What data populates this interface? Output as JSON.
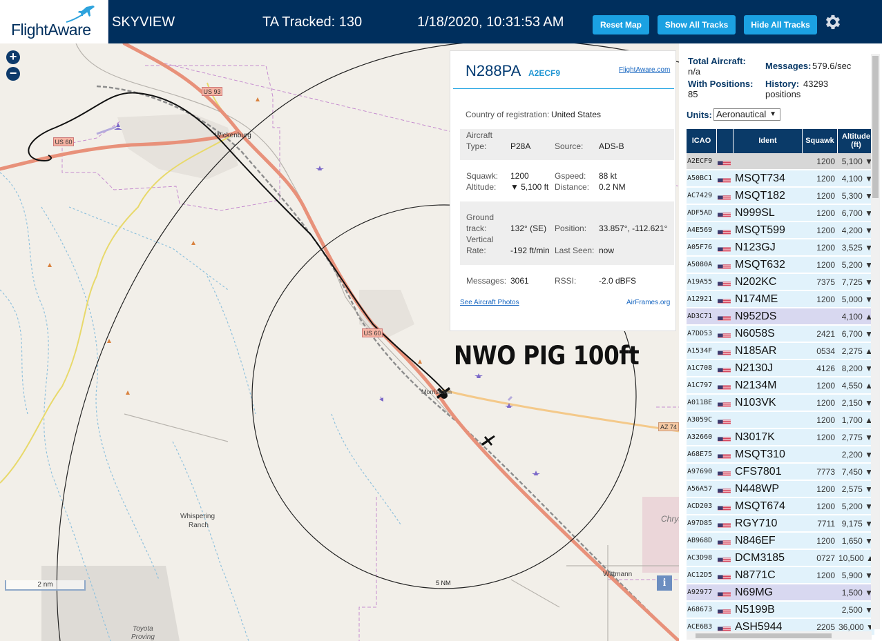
{
  "header": {
    "logo_text": "FlightAware",
    "app_name": "SKYVIEW",
    "tracked": "TA Tracked: 130",
    "datetime": "1/18/2020, 10:31:53 AM",
    "buttons": {
      "reset": "Reset Map",
      "show_all": "Show All Tracks",
      "hide_all": "Hide All Tracks"
    }
  },
  "map": {
    "zoom_in": "+",
    "zoom_out": "−",
    "scale_label": "2 nm",
    "range_label": "5 NM",
    "annotation": "NWO PIG 100ft",
    "info_button": "i",
    "places": {
      "wickenburg": "Wickenburg",
      "morristown": "Morristown",
      "whispering_ranch_1": "Whispering",
      "whispering_ranch_2": "Ranch",
      "wittmann": "Wittmann",
      "toyota_1": "Toyota",
      "toyota_2": "Proving",
      "chrys": "Chrys"
    },
    "shields": {
      "us93": "US 93",
      "us60a": "US 60",
      "us60b": "US 60",
      "az74": "AZ 74"
    }
  },
  "popup": {
    "registration": "N288PA",
    "hex": "A2ECF9",
    "link": "FlightAware.com",
    "country_label": "Country of registration:",
    "country_value": "United States",
    "type_label_1": "Aircraft",
    "type_label_2": "Type:",
    "type_value": "P28A",
    "source_label": "Source:",
    "source_value": "ADS-B",
    "squawk_label": "Squawk:",
    "squawk_value": "1200",
    "gspeed_label": "Gspeed:",
    "gspeed_value": "88 kt",
    "altitude_label": "Altitude:",
    "altitude_value": "▼ 5,100 ft",
    "distance_label": "Distance:",
    "distance_value": "0.2 NM",
    "gtrack_label_1": "Ground",
    "gtrack_label_2": "track:",
    "gtrack_value": "132° (SE)",
    "position_label": "Position:",
    "position_value": "33.857°, -112.621°",
    "vrate_label_1": "Vertical",
    "vrate_label_2": "Rate:",
    "vrate_value": "-192 ft/min",
    "lastseen_label": "Last Seen:",
    "lastseen_value": "now",
    "messages_label": "Messages:",
    "messages_value": "3061",
    "rssi_label": "RSSI:",
    "rssi_value": "-2.0 dBFS",
    "photos_link": "See Aircraft Photos",
    "airframes_link": "AirFrames.org"
  },
  "sidebar": {
    "total_label": "Total Aircraft:",
    "total_value": "n/a",
    "messages_label": "Messages:",
    "messages_value": "579.6/sec",
    "withpos_label": "With Positions:",
    "withpos_value": "85",
    "history_label": "History:",
    "history_value": "43293",
    "history_unit": "positions",
    "units_label": "Units:",
    "units_value": "Aeronautical",
    "columns": {
      "icao": "ICAO",
      "ident": "Ident",
      "squawk": "Squawk",
      "alt_1": "Altitude",
      "alt_2": "(ft)"
    },
    "rows": [
      {
        "icao": "A2ECF9",
        "ident": "",
        "squawk": "1200",
        "alt": "5,100 ▼",
        "state": "sel"
      },
      {
        "icao": "A50BC1",
        "ident": "MSQT734",
        "squawk": "1200",
        "alt": "4,100 ▼",
        "state": ""
      },
      {
        "icao": "AC7429",
        "ident": "MSQT182",
        "squawk": "1200",
        "alt": "5,300 ▼",
        "state": ""
      },
      {
        "icao": "ADF5AD",
        "ident": "N999SL",
        "squawk": "1200",
        "alt": "6,700 ▼",
        "state": ""
      },
      {
        "icao": "A4E569",
        "ident": "MSQT599",
        "squawk": "1200",
        "alt": "4,200 ▼",
        "state": ""
      },
      {
        "icao": "A05F76",
        "ident": "N123GJ",
        "squawk": "1200",
        "alt": "3,525 ▼",
        "state": ""
      },
      {
        "icao": "A5080A",
        "ident": "MSQT632",
        "squawk": "1200",
        "alt": "5,200 ▼",
        "state": ""
      },
      {
        "icao": "A19A55",
        "ident": "N202KC",
        "squawk": "7375",
        "alt": "7,725 ▼",
        "state": ""
      },
      {
        "icao": "A12921",
        "ident": "N174ME",
        "squawk": "1200",
        "alt": "5,000 ▼",
        "state": ""
      },
      {
        "icao": "AD3C71",
        "ident": "N952DS",
        "squawk": "",
        "alt": "4,100 ▲",
        "state": "nopos"
      },
      {
        "icao": "A7DD53",
        "ident": "N6058S",
        "squawk": "2421",
        "alt": "6,700 ▼",
        "state": ""
      },
      {
        "icao": "A1534F",
        "ident": "N185AR",
        "squawk": "0534",
        "alt": "2,275 ▲",
        "state": ""
      },
      {
        "icao": "A1C708",
        "ident": "N2130J",
        "squawk": "4126",
        "alt": "8,200 ▼",
        "state": ""
      },
      {
        "icao": "A1C797",
        "ident": "N2134M",
        "squawk": "1200",
        "alt": "4,550 ▲",
        "state": ""
      },
      {
        "icao": "A011BE",
        "ident": "N103VK",
        "squawk": "1200",
        "alt": "2,150 ▼",
        "state": ""
      },
      {
        "icao": "A3059C",
        "ident": "",
        "squawk": "1200",
        "alt": "1,700 ▲",
        "state": ""
      },
      {
        "icao": "A32660",
        "ident": "N3017K",
        "squawk": "1200",
        "alt": "2,775 ▼",
        "state": ""
      },
      {
        "icao": "A68E75",
        "ident": "MSQT310",
        "squawk": "",
        "alt": "2,200 ▼",
        "state": ""
      },
      {
        "icao": "A97690",
        "ident": "CFS7801",
        "squawk": "7773",
        "alt": "7,450 ▼",
        "state": ""
      },
      {
        "icao": "A56A57",
        "ident": "N448WP",
        "squawk": "1200",
        "alt": "2,575 ▼",
        "state": ""
      },
      {
        "icao": "ACD203",
        "ident": "MSQT674",
        "squawk": "1200",
        "alt": "5,200 ▼",
        "state": ""
      },
      {
        "icao": "A97D85",
        "ident": "RGY710",
        "squawk": "7711",
        "alt": "9,175 ▼",
        "state": ""
      },
      {
        "icao": "AB968D",
        "ident": "N846EF",
        "squawk": "1200",
        "alt": "1,650 ▼",
        "state": ""
      },
      {
        "icao": "AC3D98",
        "ident": "DCM3185",
        "squawk": "0727",
        "alt": "10,500 ▲",
        "state": ""
      },
      {
        "icao": "AC12D5",
        "ident": "N8771C",
        "squawk": "1200",
        "alt": "5,900 ▼",
        "state": ""
      },
      {
        "icao": "A92977",
        "ident": "N69MG",
        "squawk": "",
        "alt": "1,500 ▼",
        "state": "nopos"
      },
      {
        "icao": "A68673",
        "ident": "N5199B",
        "squawk": "",
        "alt": "2,500 ▼",
        "state": ""
      },
      {
        "icao": "ACE6B3",
        "ident": "ASH5944",
        "squawk": "2205",
        "alt": "36,000 ▼",
        "state": ""
      }
    ]
  },
  "colors": {
    "header_bg": "#002f5d",
    "button": "#1ba1e2",
    "row_bg": "#e1f2fb",
    "highway": "#e8917a"
  }
}
